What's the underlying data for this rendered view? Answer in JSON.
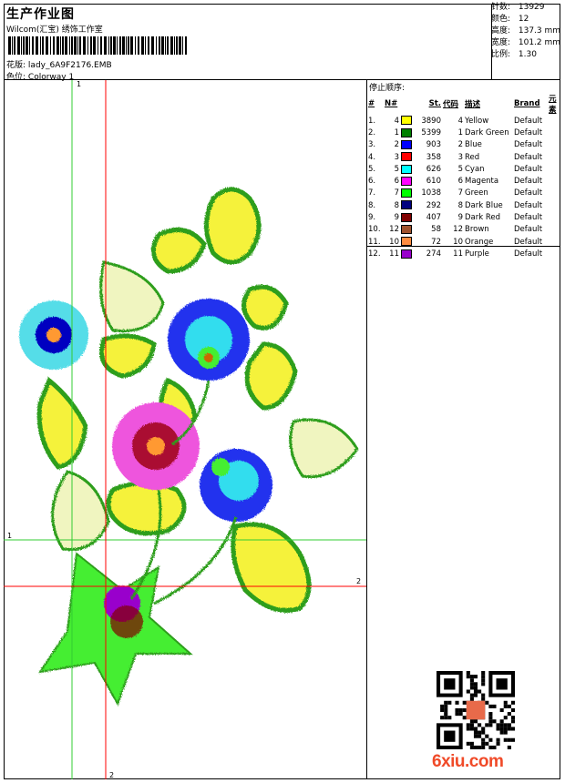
{
  "header": {
    "title": "生产作业图",
    "company": "Wilcom(汇宝) 绣饰工作室",
    "filename_label": "花版:",
    "filename": "lady_6A9F2176.EMB",
    "colorway_label": "色位:",
    "colorway": "Colorway 1"
  },
  "stats": [
    {
      "label": "针数:",
      "value": "13929"
    },
    {
      "label": "颜色:",
      "value": "12"
    },
    {
      "label": "高度:",
      "value": "137.3 mm"
    },
    {
      "label": "宽度:",
      "value": "101.2 mm"
    },
    {
      "label": "比例:",
      "value": "1.30"
    }
  ],
  "stop_sequence": {
    "title": "停止顺序:",
    "headers": [
      "#",
      "N#",
      "St.",
      "代码",
      "描述",
      "Brand",
      "元素"
    ],
    "rows": [
      {
        "idx": "1.",
        "n": "4",
        "color": "#ffff00",
        "st": "3890",
        "code": "4",
        "desc": "Yellow",
        "brand": "Default"
      },
      {
        "idx": "2.",
        "n": "1",
        "color": "#008000",
        "st": "5399",
        "code": "1",
        "desc": "Dark Green",
        "brand": "Default"
      },
      {
        "idx": "3.",
        "n": "2",
        "color": "#0000ff",
        "st": "903",
        "code": "2",
        "desc": "Blue",
        "brand": "Default"
      },
      {
        "idx": "4.",
        "n": "3",
        "color": "#ff0000",
        "st": "358",
        "code": "3",
        "desc": "Red",
        "brand": "Default"
      },
      {
        "idx": "5.",
        "n": "5",
        "color": "#00ffff",
        "st": "626",
        "code": "5",
        "desc": "Cyan",
        "brand": "Default"
      },
      {
        "idx": "6.",
        "n": "6",
        "color": "#ff00ff",
        "st": "610",
        "code": "6",
        "desc": "Magenta",
        "brand": "Default"
      },
      {
        "idx": "7.",
        "n": "7",
        "color": "#00ff00",
        "st": "1038",
        "code": "7",
        "desc": "Green",
        "brand": "Default"
      },
      {
        "idx": "8.",
        "n": "8",
        "color": "#000080",
        "st": "292",
        "code": "8",
        "desc": "Dark Blue",
        "brand": "Default"
      },
      {
        "idx": "9.",
        "n": "9",
        "color": "#800000",
        "st": "407",
        "code": "9",
        "desc": "Dark Red",
        "brand": "Default"
      },
      {
        "idx": "10.",
        "n": "12",
        "color": "#a0522d",
        "st": "58",
        "code": "12",
        "desc": "Brown",
        "brand": "Default"
      },
      {
        "idx": "11.",
        "n": "10",
        "color": "#ff8c40",
        "st": "72",
        "code": "10",
        "desc": "Orange",
        "brand": "Default"
      },
      {
        "idx": "12.",
        "n": "11",
        "color": "#9900cc",
        "st": "274",
        "code": "11",
        "desc": "Purple",
        "brand": "Default"
      }
    ]
  },
  "guides": {
    "v1": "1",
    "h1": "1",
    "v2": "2",
    "h2": "2"
  },
  "colors": {
    "guide1": "#33cc33",
    "guide2": "#ff0000",
    "logo": "#f04a28"
  },
  "watermark": "6xiu.com"
}
